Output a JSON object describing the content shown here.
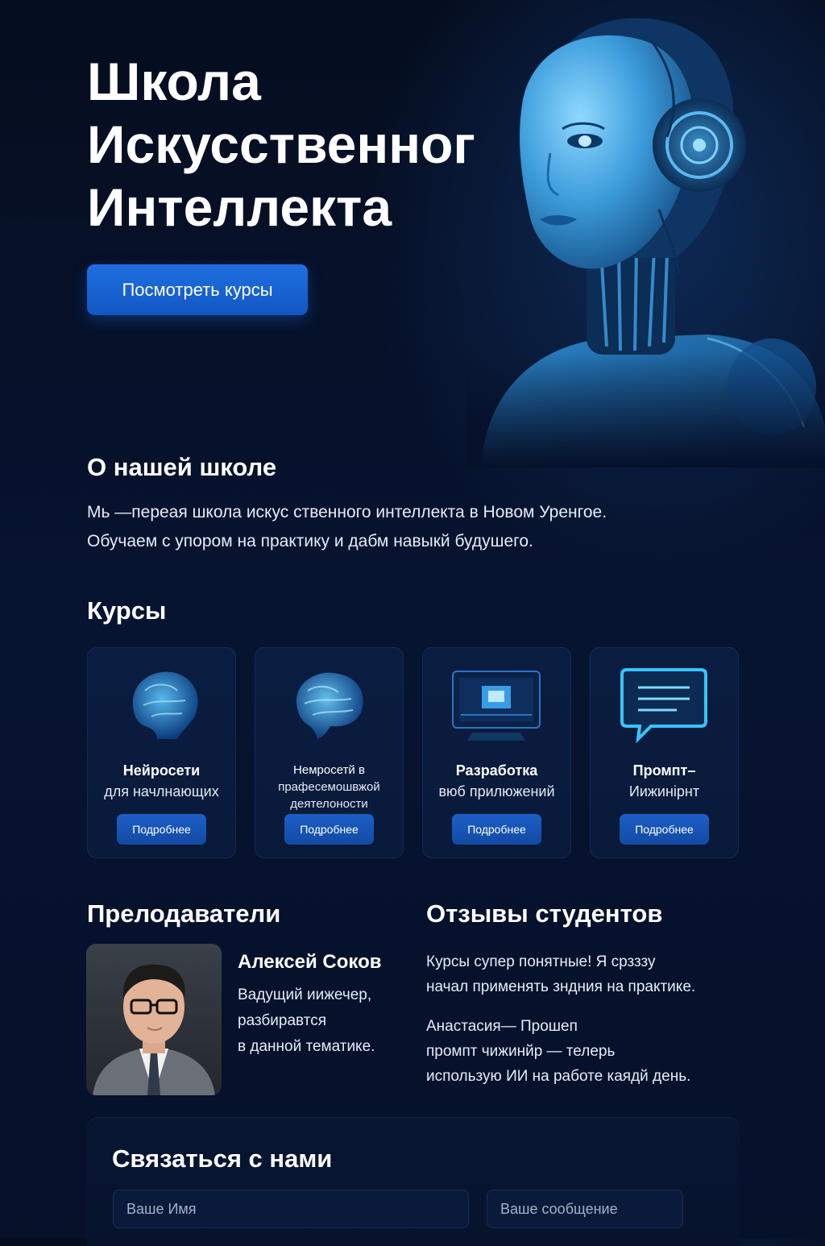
{
  "hero": {
    "title_lines": [
      "Школа",
      "Искусственног",
      "Интеллекта"
    ],
    "cta_label": "Посмотреть курсы"
  },
  "about": {
    "heading": "О нашей школе",
    "text_lines": [
      "Мь —переая школа искус ственного интеллекта в Новом Уренгое.",
      "Обучаем с упором на практику и дабм навыкй будушего."
    ]
  },
  "courses": {
    "heading": "Курсы",
    "items": [
      {
        "line1": "Нейросети",
        "line2": "для начлнающих",
        "button": "Подробнее",
        "icon": "brain-head-icon"
      },
      {
        "line1": "Немросетй в",
        "line2": "прафесемошвжой деятелоности",
        "button": "Подробнее",
        "icon": "brain-icon"
      },
      {
        "line1": "Разработка",
        "line2": "вюб прилюжений",
        "button": "Подробнее",
        "icon": "monitor-icon"
      },
      {
        "line1": "Промпт–",
        "line2": "Иижинірнт",
        "button": "Подробнее",
        "icon": "chat-bubble-icon"
      }
    ]
  },
  "teachers": {
    "heading": "Прелодаватели",
    "name": "Алексей Соков",
    "desc_lines": [
      "Вадущий иижечер,",
      "разбиравтся",
      "в данной тематике."
    ]
  },
  "reviews": {
    "heading": "Отзывы студентов",
    "review1_lines": [
      "Курсы супер понятные! Я срзззу",
      "начал применять зндния на практике."
    ],
    "review2_lines": [
      "Анастасия— Прошеп",
      "промпт чижинйр — телерь",
      "иcпользую ИИ на работе каядй день."
    ]
  },
  "contact": {
    "heading": "Связаться с нами",
    "name_placeholder": "Ваше Имя",
    "message_placeholder": "Ваше сообщение"
  },
  "colors": {
    "background": "#061029",
    "accent": "#1f6fe0",
    "card": "#0a1c40",
    "glow": "#29a8ff"
  }
}
